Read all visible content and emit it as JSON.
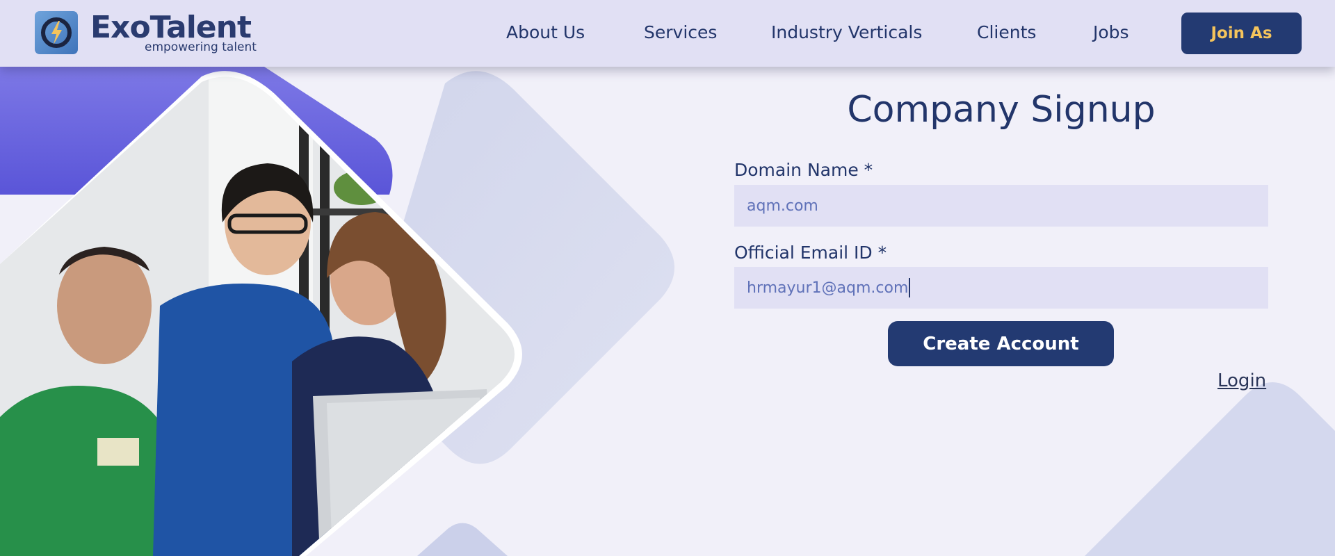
{
  "brand": {
    "name": "ExoTalent",
    "tagline": "empowering talent",
    "logo_icon": "lightning-circle-icon"
  },
  "nav": {
    "items": [
      {
        "label": "About Us"
      },
      {
        "label": "Services"
      },
      {
        "label": "Industry Verticals"
      },
      {
        "label": "Clients"
      },
      {
        "label": "Jobs"
      }
    ],
    "join_label": "Join As"
  },
  "form": {
    "title": "Company Signup",
    "domain": {
      "label": "Domain Name *",
      "value": "aqm.com"
    },
    "email": {
      "label": "Official Email ID *",
      "value": "hrmayur1@aqm.com"
    },
    "submit_label": "Create Account",
    "login_label": "Login"
  },
  "colors": {
    "header_bg": "#e1e0f4",
    "page_bg": "#f1f0f9",
    "primary": "#233a72",
    "accent_gold": "#f5c45c",
    "decor_purple": "#6a66e0",
    "field_bg": "#e1e0f4",
    "field_text": "#5f71b8"
  }
}
